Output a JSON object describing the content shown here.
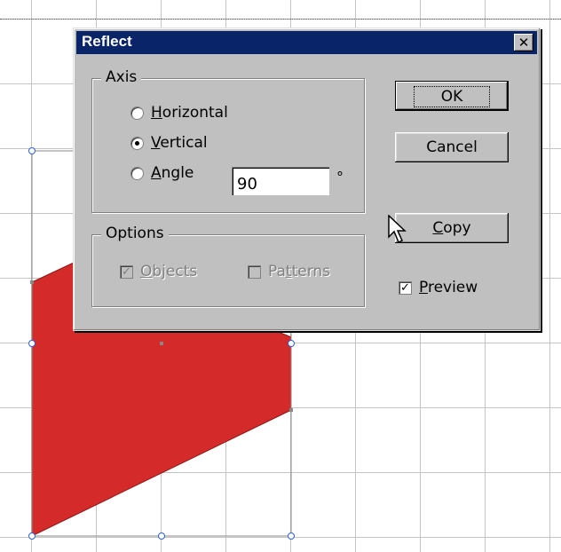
{
  "dialog": {
    "title": "Reflect",
    "close_label": "✕",
    "axis": {
      "label": "Axis",
      "options": [
        {
          "label": "Horizontal",
          "mnemonic": "H",
          "rest": "orizontal",
          "selected": false
        },
        {
          "label": "Vertical",
          "mnemonic": "V",
          "rest": "ertical",
          "selected": true
        },
        {
          "label": "Angle",
          "mnemonic": "A",
          "rest": "ngle",
          "selected": false
        }
      ],
      "angle_value": "90",
      "degree_symbol": "°"
    },
    "options_group": {
      "label": "Options",
      "objects": {
        "label": "Objects",
        "mnemonic": "O",
        "rest": "bjects",
        "checked": true,
        "enabled": false
      },
      "patterns": {
        "label": "Patterns",
        "pre": "Pa",
        "mnemonic": "t",
        "rest": "terns",
        "checked": false,
        "enabled": false
      }
    },
    "buttons": {
      "ok": "OK",
      "cancel": "Cancel",
      "copy": {
        "label": "Copy",
        "mnemonic": "C",
        "rest": "opy"
      }
    },
    "preview": {
      "label": "Preview",
      "mnemonic": "P",
      "rest": "review",
      "checked": true
    }
  },
  "colors": {
    "dialog_bg": "#c0c0c0",
    "title_bar": "#0a246a",
    "shape_fill": "#d42a2a",
    "grid": "#c4c4c4"
  }
}
